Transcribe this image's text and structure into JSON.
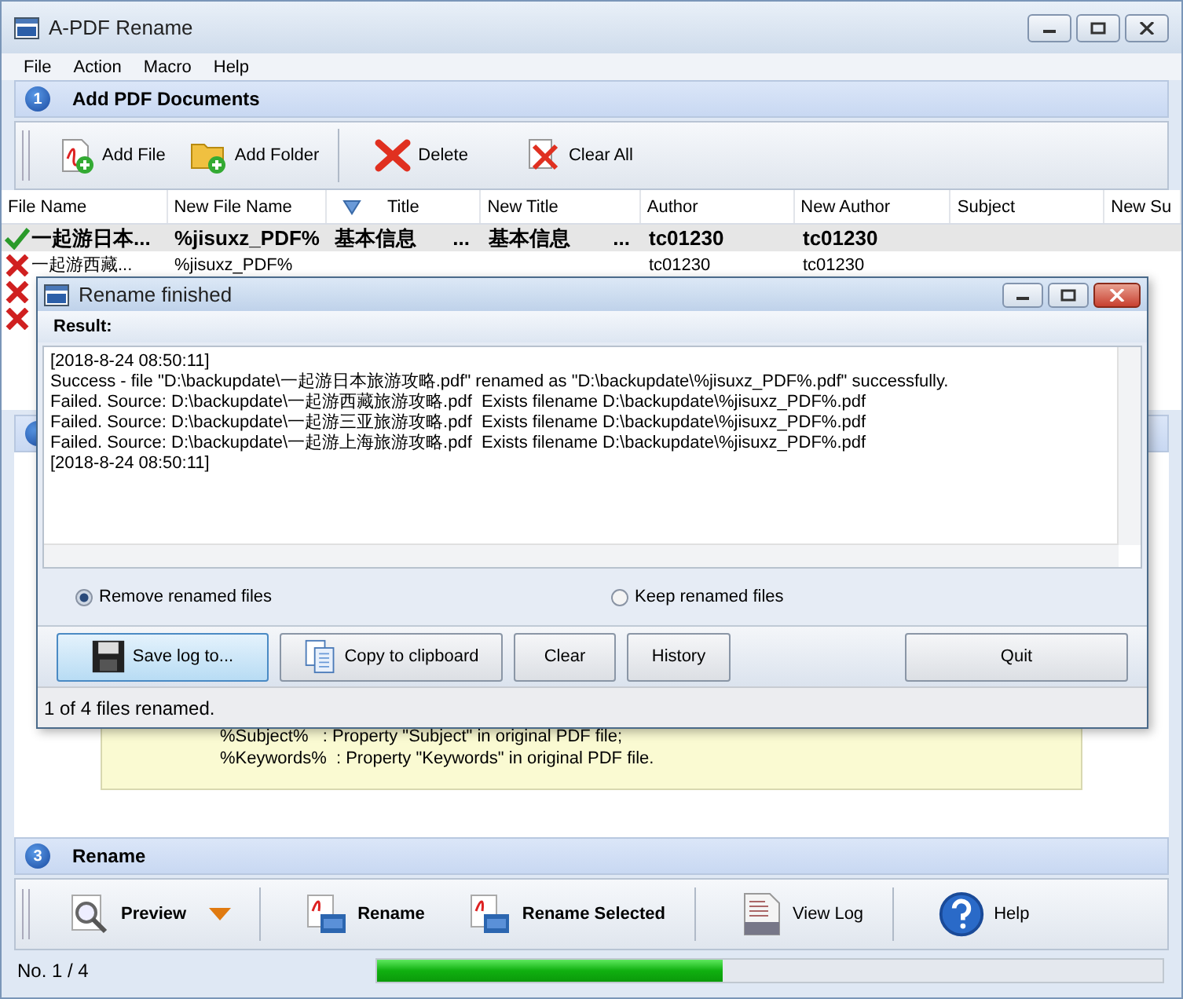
{
  "window": {
    "title": "A-PDF Rename"
  },
  "menu": [
    "File",
    "Action",
    "Macro",
    "Help"
  ],
  "section_1": {
    "number": "1",
    "title": "Add PDF Documents"
  },
  "toolbar_1": [
    "Add File",
    "Add Folder",
    "Delete",
    "Clear All"
  ],
  "table": {
    "columns": [
      {
        "label": "File Name",
        "sorted": false
      },
      {
        "label": "New File Name",
        "sorted": false
      },
      {
        "label": "Title",
        "sorted": true
      },
      {
        "label": "New Title",
        "sorted": false
      },
      {
        "label": "Author",
        "sorted": false
      },
      {
        "label": "New Author",
        "sorted": false
      },
      {
        "label": "Subject",
        "sorted": false
      },
      {
        "label": "New Su",
        "sorted": false
      }
    ],
    "rows": [
      {
        "kind": "ok",
        "selected": true,
        "cells": [
          "一起游日本...",
          "%jisuxz_PDF%",
          "基本信息",
          "基本信息",
          "tc01230",
          "tc01230"
        ],
        "more": [
          "...",
          "..."
        ]
      },
      {
        "kind": "failed",
        "selected": false,
        "cells": [
          "一起游西藏...",
          "%jisuxz_PDF%",
          "",
          "",
          "tc01230",
          "tc01230"
        ],
        "more": []
      },
      {
        "kind": "failed",
        "selected": false,
        "cells": [],
        "more": []
      },
      {
        "kind": "failed",
        "selected": false,
        "cells": [],
        "more": []
      }
    ]
  },
  "notes": [
    "%Subject%   : Property \"Subject\" in original PDF file;",
    "%Keywords%  : Property \"Keywords\" in original PDF file."
  ],
  "section_3": {
    "number": "3",
    "title": "Rename"
  },
  "toolbar_3": [
    "Preview",
    "Rename",
    "Rename Selected",
    "View Log",
    "Help"
  ],
  "status_bar": {
    "text": "No. 1 / 4",
    "level": 0.44
  },
  "dialog": {
    "title": "Rename finished",
    "result_label": "Result:",
    "log": [
      "[2018-8-24 08:50:11]",
      "Success - file \"D:\\backupdate\\一起游日本旅游攻略.pdf\" renamed as \"D:\\backupdate\\%jisuxz_PDF%.pdf\" successfully.",
      "Failed. Source: D:\\backupdate\\一起游西藏旅游攻略.pdf  Exists filename D:\\backupdate\\%jisuxz_PDF%.pdf",
      "Failed. Source: D:\\backupdate\\一起游三亚旅游攻略.pdf  Exists filename D:\\backupdate\\%jisuxz_PDF%.pdf",
      "Failed. Source: D:\\backupdate\\一起游上海旅游攻略.pdf  Exists filename D:\\backupdate\\%jisuxz_PDF%.pdf",
      "[2018-8-24 08:50:11]"
    ],
    "options": [
      {
        "label": "Remove renamed files",
        "selected": true
      },
      {
        "label": "Keep renamed files",
        "selected": false
      }
    ],
    "buttons": [
      {
        "label": "Save log to...",
        "focused": true
      },
      {
        "label": "Copy to clipboard",
        "focused": false
      },
      {
        "label": "Clear",
        "focused": false
      },
      {
        "label": "History",
        "focused": false
      },
      {
        "label": "Quit",
        "focused": false
      }
    ],
    "status": "1 of 4 files renamed."
  }
}
